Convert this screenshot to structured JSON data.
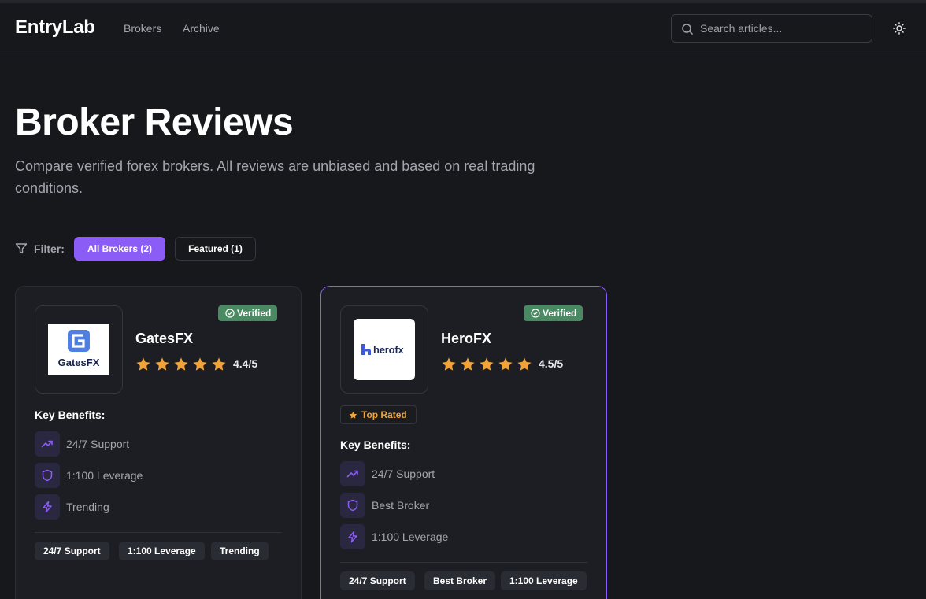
{
  "header": {
    "logo": "EntryLab",
    "nav": [
      "Brokers",
      "Archive"
    ],
    "search_placeholder": "Search articles..."
  },
  "page": {
    "title": "Broker Reviews",
    "subtitle": "Compare verified forex brokers. All reviews are unbiased and based on real trading conditions."
  },
  "filter": {
    "label": "Filter:",
    "options": [
      "All Brokers (2)",
      "Featured (1)"
    ],
    "selected": "All Brokers (2)"
  },
  "brokers": [
    {
      "name": "GatesFX",
      "logo_text": "GatesFX",
      "verified": "Verified",
      "rating": "4.4/5",
      "stars": 4.4,
      "top_rated": null,
      "key_benefits_title": "Key Benefits:",
      "benefits": [
        "24/7 Support",
        "1:100 Leverage",
        "Trending"
      ],
      "tags": [
        "24/7 Support",
        "1:100 Leverage",
        "Trending"
      ],
      "featured": false
    },
    {
      "name": "HeroFX",
      "logo_text": "herofx",
      "verified": "Verified",
      "rating": "4.5/5",
      "stars": 4.5,
      "top_rated": "Top Rated",
      "key_benefits_title": "Key Benefits:",
      "benefits": [
        "24/7 Support",
        "Best Broker",
        "1:100 Leverage"
      ],
      "tags": [
        "24/7 Support",
        "Best Broker",
        "1:100 Leverage"
      ],
      "featured": true
    }
  ],
  "colors": {
    "background": "#17181c",
    "card": "#1d1e23",
    "accent": "#8b5cf6",
    "verified": "#4a8a62",
    "star": "#f0a33b",
    "muted_text": "#a3a6ae"
  },
  "icons": {
    "search": "search-icon",
    "theme": "sun-icon",
    "filter": "filter-icon",
    "verified": "check-circle-icon",
    "star": "star-icon",
    "benefit_1": "trending-up-icon",
    "benefit_2": "shield-icon",
    "benefit_3": "lightning-icon"
  }
}
